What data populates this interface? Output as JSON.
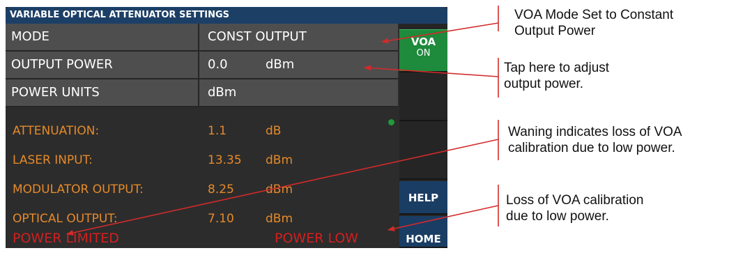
{
  "screen": {
    "title": "VARIABLE OPTICAL ATTENUATOR SETTINGS",
    "rows": [
      {
        "label": "MODE",
        "value": "CONST OUTPUT",
        "unit": ""
      },
      {
        "label": "OUTPUT POWER",
        "value": "0.0",
        "unit": "dBm"
      },
      {
        "label": "POWER UNITS",
        "value": "dBm",
        "unit": ""
      }
    ],
    "status": [
      {
        "label": "ATTENUATION:",
        "value": "1.1",
        "unit": "dB"
      },
      {
        "label": "LASER INPUT:",
        "value": "13.35",
        "unit": "dBm"
      },
      {
        "label": "MODULATOR OUTPUT:",
        "value": "8.25",
        "unit": "dBm"
      },
      {
        "label": "OPTICAL OUTPUT:",
        "value": "7.10",
        "unit": "dBm"
      }
    ],
    "warnings": {
      "left": "POWER LIMITED",
      "right": "POWER LOW"
    },
    "side_buttons": {
      "voa_label": "VOA",
      "voa_state": "ON",
      "help": "HELP",
      "home": "HOME"
    },
    "colors": {
      "title_bar": "#1c3f66",
      "voa_on": "#1e8a3b",
      "status_text": "#e68a2a",
      "warning_text": "#d31f1f",
      "nav_button": "#1a3d64"
    }
  },
  "annotations": [
    {
      "line1": "VOA Mode Set to Constant",
      "line2": "Output Power"
    },
    {
      "line1": "Tap here to adjust",
      "line2": "output power."
    },
    {
      "line1": "Waning indicates loss of VOA",
      "line2": "calibration due to low power."
    },
    {
      "line1": "Loss of VOA calibration",
      "line2": "due to low power."
    }
  ]
}
